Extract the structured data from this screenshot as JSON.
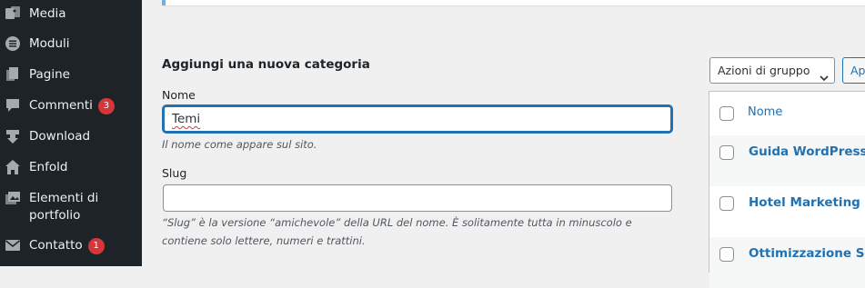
{
  "sidebar": {
    "items": [
      {
        "label": "Media",
        "icon": "media-icon"
      },
      {
        "label": "Moduli",
        "icon": "forms-icon"
      },
      {
        "label": "Pagine",
        "icon": "pages-icon"
      },
      {
        "label": "Commenti",
        "icon": "comments-icon",
        "badge": "3"
      },
      {
        "label": "Download",
        "icon": "download-icon"
      },
      {
        "label": "Enfold",
        "icon": "home-icon"
      },
      {
        "label": "Elementi di portfolio",
        "icon": "portfolio-icon"
      },
      {
        "label": "Contatto",
        "icon": "mail-icon",
        "badge": "1"
      }
    ]
  },
  "form": {
    "title": "Aggiungi una nuova categoria",
    "name_label": "Nome",
    "name_value": "Temi",
    "name_desc": "Il nome come appare sul sito.",
    "slug_label": "Slug",
    "slug_value": "",
    "slug_desc": "“Slug” è la versione “amichevole” della URL del nome. È solitamente tutta in minuscolo e contiene solo lettere, numeri e trattini."
  },
  "list": {
    "bulk_actions": "Azioni di gruppo",
    "apply_label": "Ap",
    "column_name": "Nome",
    "rows": [
      "Guida WordPress",
      "Hotel Marketing",
      "Ottimizzazione Siti W"
    ]
  },
  "colors": {
    "sidebar_bg": "#1d2327",
    "accent": "#2271b1",
    "badge": "#d63638"
  }
}
